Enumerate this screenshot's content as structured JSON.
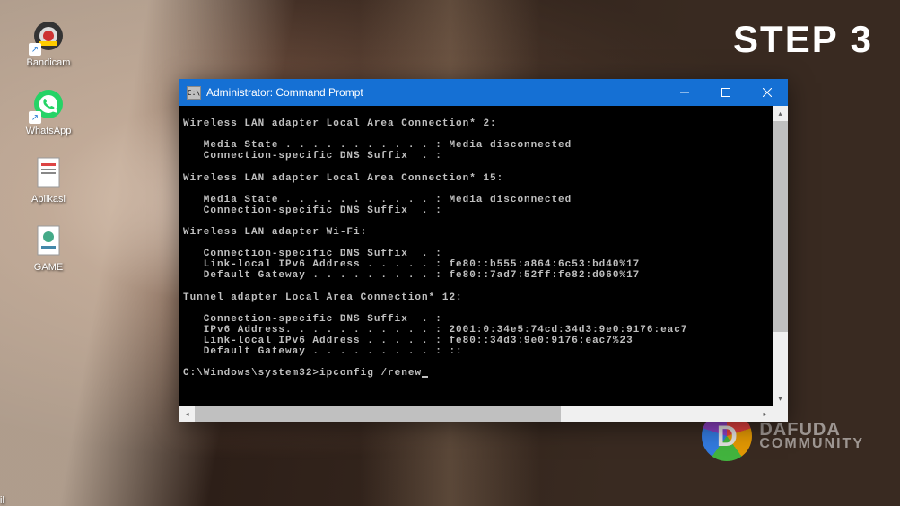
{
  "step_label": "STEP 3",
  "desktop": {
    "icons": [
      {
        "name": "bandicam",
        "label": "Bandicam",
        "bg": "#ddd"
      },
      {
        "name": "whatsapp",
        "label": "WhatsApp",
        "bg": "#25d366"
      },
      {
        "name": "aplikasi",
        "label": "Aplikasi",
        "bg": "#fff"
      },
      {
        "name": "game",
        "label": "GAME",
        "bg": "#fff"
      }
    ],
    "partial_label": "il"
  },
  "cmd": {
    "title": "Administrator: Command Prompt",
    "lines": [
      "",
      "Wireless LAN adapter Local Area Connection* 2:",
      "",
      "   Media State . . . . . . . . . . . : Media disconnected",
      "   Connection-specific DNS Suffix  . :",
      "",
      "Wireless LAN adapter Local Area Connection* 15:",
      "",
      "   Media State . . . . . . . . . . . : Media disconnected",
      "   Connection-specific DNS Suffix  . :",
      "",
      "Wireless LAN adapter Wi-Fi:",
      "",
      "   Connection-specific DNS Suffix  . :",
      "   Link-local IPv6 Address . . . . . : fe80::b555:a864:6c53:bd40%17",
      "   Default Gateway . . . . . . . . . : fe80::7ad7:52ff:fe82:d060%17",
      "",
      "Tunnel adapter Local Area Connection* 12:",
      "",
      "   Connection-specific DNS Suffix  . :",
      "   IPv6 Address. . . . . . . . . . . : 2001:0:34e5:74cd:34d3:9e0:9176:eac7",
      "   Link-local IPv6 Address . . . . . : fe80::34d3:9e0:9176:eac7%23",
      "   Default Gateway . . . . . . . . . : ::",
      ""
    ],
    "prompt": "C:\\Windows\\system32>",
    "command": "ipconfig /renew"
  },
  "watermark": {
    "line1": "DAFUDA",
    "line2": "COMMUNITY"
  }
}
